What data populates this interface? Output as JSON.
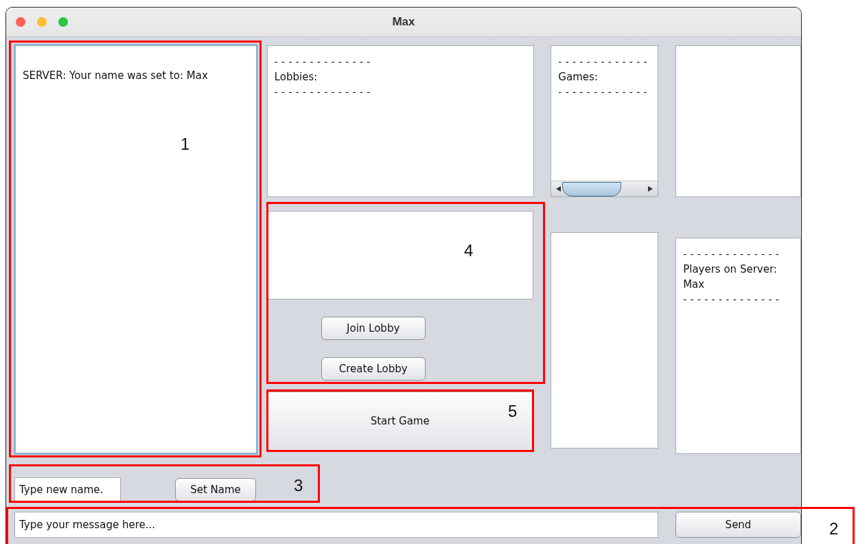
{
  "window": {
    "title": "Max"
  },
  "chat_log": {
    "focused": true,
    "lines": [
      "SERVER: Your name was set to: Max"
    ]
  },
  "lobbies_list": {
    "lines": [
      {
        "kind": "separator",
        "text": "--------------"
      },
      {
        "kind": "text",
        "text": "Lobbies:"
      },
      {
        "kind": "separator",
        "text": "--------------"
      }
    ]
  },
  "games_list": {
    "horizontal_scrollbar": true,
    "lines": [
      {
        "kind": "separator",
        "text": "-------------"
      },
      {
        "kind": "text",
        "text": "Games:"
      },
      {
        "kind": "separator",
        "text": "-------------"
      }
    ]
  },
  "lobby_buttons": [
    {
      "label": "Join Lobby"
    },
    {
      "label": "Create Lobby"
    }
  ],
  "start_button": {
    "label": "Start Game"
  },
  "players_list": {
    "lines": [
      {
        "kind": "separator",
        "text": "--------------"
      },
      {
        "kind": "text",
        "text": "Players on Server:"
      },
      {
        "kind": "text",
        "text": "Max"
      },
      {
        "kind": "separator",
        "text": "--------------"
      }
    ]
  },
  "name_field": {
    "value": "Type new name."
  },
  "set_name_button": {
    "label": "Set Name"
  },
  "message_field": {
    "value": "Type your message here..."
  },
  "send_button": {
    "label": "Send"
  },
  "annotations": [
    {
      "label": "1"
    },
    {
      "label": "4"
    },
    {
      "label": "5"
    },
    {
      "label": "3"
    },
    {
      "label": "2"
    }
  ]
}
